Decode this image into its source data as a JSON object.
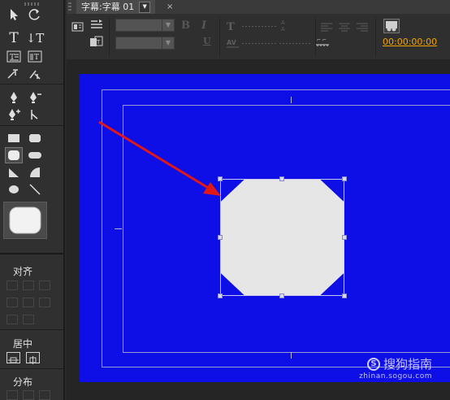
{
  "tab": {
    "title": "字幕:字幕 01",
    "dropdown_glyph": "▼",
    "close_glyph": "×"
  },
  "toolbar": {
    "bold_glyph": "B",
    "italic_glyph": "I",
    "underline_glyph": "U",
    "timecode": "00:00:00:00"
  },
  "left_panel": {
    "text_tool_glyph": "T",
    "vertical_text_tool_glyph": "↓T",
    "align_label": "对齐",
    "center_label": "居中",
    "distribute_label": "分布"
  },
  "watermark": {
    "logo_letter": "S",
    "brand": "搜狗指南",
    "url": "zhinan.sogou.com"
  },
  "colors": {
    "canvas_background": "#0e0ee6",
    "shape_fill": "#e6e6e6",
    "arrow": "#e01818",
    "timecode": "#f0a400",
    "panel": "#303030"
  },
  "icons": [
    "selection-tool-icon",
    "rotation-tool-icon",
    "text-tool-icon",
    "vertical-text-tool-icon",
    "area-text-tool-icon",
    "vertical-area-text-tool-icon",
    "path-text-tool-icon",
    "vertical-path-text-tool-icon",
    "pen-tool-icon",
    "delete-anchor-point-tool-icon",
    "add-anchor-point-tool-icon",
    "convert-anchor-point-tool-icon",
    "rectangle-tool-icon",
    "rounded-corner-rectangle-tool-icon",
    "clipped-corner-rectangle-tool-icon",
    "rounded-rectangle-tool-icon",
    "wedge-tool-icon",
    "arc-tool-icon",
    "ellipse-tool-icon",
    "line-tool-icon"
  ]
}
